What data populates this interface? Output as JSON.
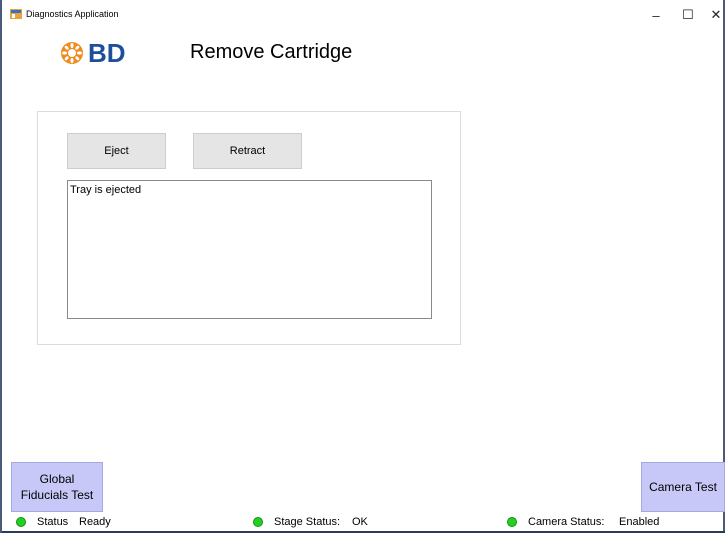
{
  "window": {
    "title": "Diagnostics Application",
    "minimize_glyph": "–",
    "maximize_glyph": "☐",
    "close_glyph": "✕"
  },
  "logo": {
    "text": "BD",
    "brand_color": "#1f4f9a",
    "sun_color": "#f08a1c"
  },
  "page": {
    "title": "Remove Cartridge"
  },
  "controls": {
    "eject_label": "Eject",
    "retract_label": "Retract",
    "log_text": "Tray is ejected"
  },
  "side_buttons": {
    "global_fiducials_line1": "Global",
    "global_fiducials_line2": "Fiducials Test",
    "camera_test": "Camera Test",
    "color": "#c8c8f8"
  },
  "status": {
    "status_label": "Status",
    "status_value": "Ready",
    "stage_label": "Stage Status:",
    "stage_value": "OK",
    "camera_label": "Camera Status:",
    "camera_value": "Enabled",
    "indicator_color": "#22d022"
  }
}
